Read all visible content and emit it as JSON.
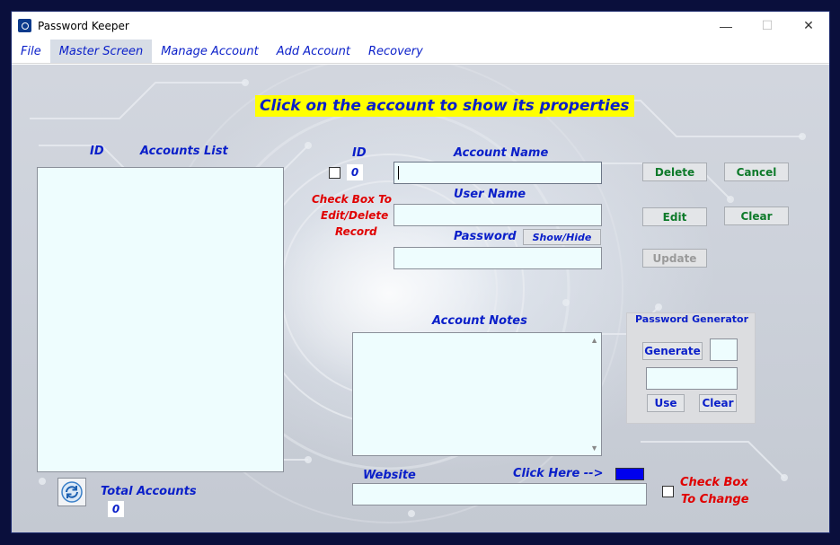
{
  "window": {
    "title": "Password Keeper",
    "minimize": "—",
    "maximize": "☐",
    "close": "✕"
  },
  "menu": {
    "items": [
      "File",
      "Master Screen",
      "Manage Account",
      "Add Account",
      "Recovery"
    ],
    "active": "Master Screen"
  },
  "banner": "Click on the account to show its properties",
  "list": {
    "id_label": "ID",
    "title": "Accounts List",
    "total_label": "Total Accounts",
    "total_value": "0"
  },
  "record": {
    "id_label": "ID",
    "id_value": "0",
    "check_hint_line1": "Check Box To",
    "check_hint_line2": "Edit/Delete",
    "check_hint_line3": "Record"
  },
  "fields": {
    "account_name_label": "Account Name",
    "account_name_value": "",
    "user_name_label": "User Name",
    "user_name_value": "",
    "password_label": "Password",
    "password_value": "",
    "show_hide_label": "Show/Hide",
    "notes_label": "Account Notes",
    "notes_value": "",
    "website_label": "Website",
    "website_value": "",
    "click_here_label": "Click Here  -->",
    "check_change_line1": "Check Box",
    "check_change_line2": "To Change"
  },
  "actions": {
    "delete": "Delete",
    "cancel": "Cancel",
    "edit": "Edit",
    "clear": "Clear",
    "update": "Update"
  },
  "generator": {
    "title": "Password Generator",
    "generate": "Generate",
    "use": "Use",
    "clear": "Clear",
    "length_value": "",
    "output_value": ""
  },
  "colors": {
    "link_swatch": "#0000ee",
    "banner": "#ffff00",
    "label_blue": "#0a1fc9",
    "hint_red": "#e00000"
  }
}
